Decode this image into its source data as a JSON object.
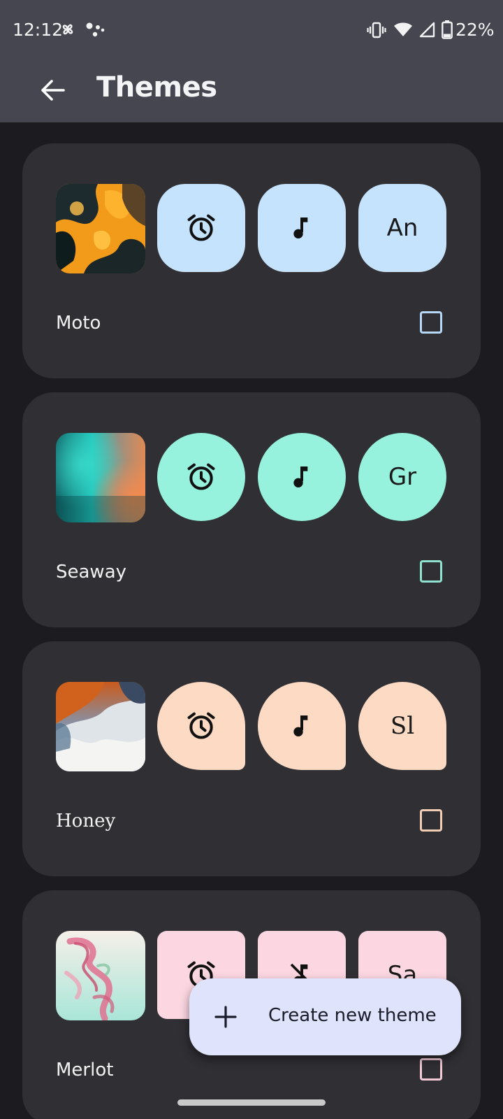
{
  "status_bar": {
    "time": "12:12",
    "battery_percent": "22%",
    "icons": [
      "pinwheel-icon",
      "assistant-dots-icon",
      "vibrate-icon",
      "wifi-icon",
      "signal-icon",
      "battery-icon"
    ]
  },
  "app_bar": {
    "back_icon": "arrow-left-icon",
    "title": "Themes"
  },
  "themes": [
    {
      "name": "Moto",
      "wallpaper": "orange-dark-abstract",
      "tile_shape": "squircle",
      "tile_color": "#c6e3fd",
      "checkbox_color": "#b6d7f6",
      "font_sample": "An",
      "font_style": "sans",
      "icons": [
        "alarm-clock-icon",
        "music-note-icon"
      ],
      "selected": false
    },
    {
      "name": "Seaway",
      "wallpaper": "teal-orange-blur",
      "tile_shape": "circle",
      "tile_color": "#96f2dd",
      "checkbox_color": "#8ee2cf",
      "font_sample": "Gr",
      "font_style": "sans",
      "icons": [
        "alarm-clock-icon",
        "music-note-icon"
      ],
      "selected": false
    },
    {
      "name": "Honey",
      "wallpaper": "orange-white-wave",
      "tile_shape": "leaf",
      "tile_color": "#fcdac4",
      "checkbox_color": "#f2cdb5",
      "font_sample": "Sl",
      "font_style": "serif",
      "icons": [
        "alarm-clock-icon",
        "music-note-icon"
      ],
      "selected": false
    },
    {
      "name": "Merlot",
      "wallpaper": "pink-feather",
      "tile_shape": "square",
      "tile_color": "#fcd7e1",
      "checkbox_color": "#f2c9d4",
      "font_sample": "Sa",
      "font_style": "sans",
      "icons": [
        "alarm-clock-icon",
        "music-off-icon"
      ],
      "selected": false
    }
  ],
  "fab": {
    "icon": "plus-icon",
    "label": "Create new theme"
  }
}
